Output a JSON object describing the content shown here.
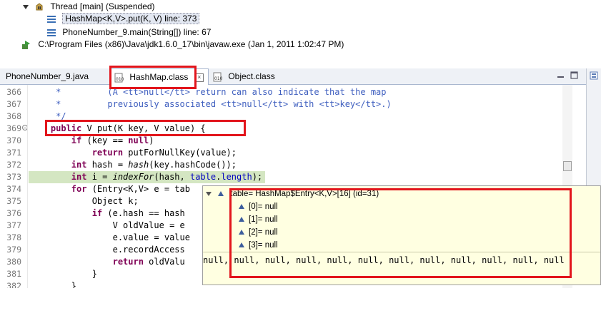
{
  "debug": {
    "thread": "Thread [main] (Suspended)",
    "frames": [
      "HashMap<K,V>.put(K, V) line: 373",
      "PhoneNumber_9.main(String[]) line: 67"
    ],
    "process": "C:\\Program Files (x86)\\Java\\jdk1.6.0_17\\bin\\javaw.exe (Jan 1, 2011 1:02:47 PM)"
  },
  "tabs": [
    {
      "label": "PhoneNumber_9.java",
      "active": false
    },
    {
      "label": "HashMap.class",
      "active": true
    },
    {
      "label": "Object.class",
      "active": false
    }
  ],
  "editor": {
    "current_line": 373,
    "lines": [
      {
        "n": "366",
        "text": "     *         (A <tt>null</tt> return can also indicate that the map"
      },
      {
        "n": "367",
        "text": "     *         previously associated <tt>null</tt> with <tt>key</tt>.)"
      },
      {
        "n": "368",
        "text": "     */"
      },
      {
        "n": "369",
        "text": "    public V put(K key, V value) {"
      },
      {
        "n": "370",
        "text": "        if (key == null)"
      },
      {
        "n": "371",
        "text": "            return putForNullKey(value);"
      },
      {
        "n": "372",
        "text": "        int hash = hash(key.hashCode());"
      },
      {
        "n": "373",
        "text": "        int i = indexFor(hash, table.length);"
      },
      {
        "n": "374",
        "text": "        for (Entry<K,V> e = tab"
      },
      {
        "n": "375",
        "text": "            Object k;"
      },
      {
        "n": "376",
        "text": "            if (e.hash == hash"
      },
      {
        "n": "377",
        "text": "                V oldValue = e"
      },
      {
        "n": "378",
        "text": "                e.value = value"
      },
      {
        "n": "379",
        "text": "                e.recordAccess"
      },
      {
        "n": "380",
        "text": "                return oldValu"
      },
      {
        "n": "381",
        "text": "            }"
      },
      {
        "n": "382",
        "text": "        }"
      }
    ]
  },
  "hover": {
    "root": "table= HashMap$Entry<K,V>[16]  (id=31)",
    "children": [
      "[0]= null",
      "[1]= null",
      "[2]= null",
      "[3]= null"
    ],
    "detail": "null, null, null, null, null, null, null, null, null, null, null, null"
  },
  "colors": {
    "highlight": "#e2151c",
    "current_line": "#d4e6c2",
    "keyword": "#7f0055",
    "comment": "#3f5fbf"
  }
}
